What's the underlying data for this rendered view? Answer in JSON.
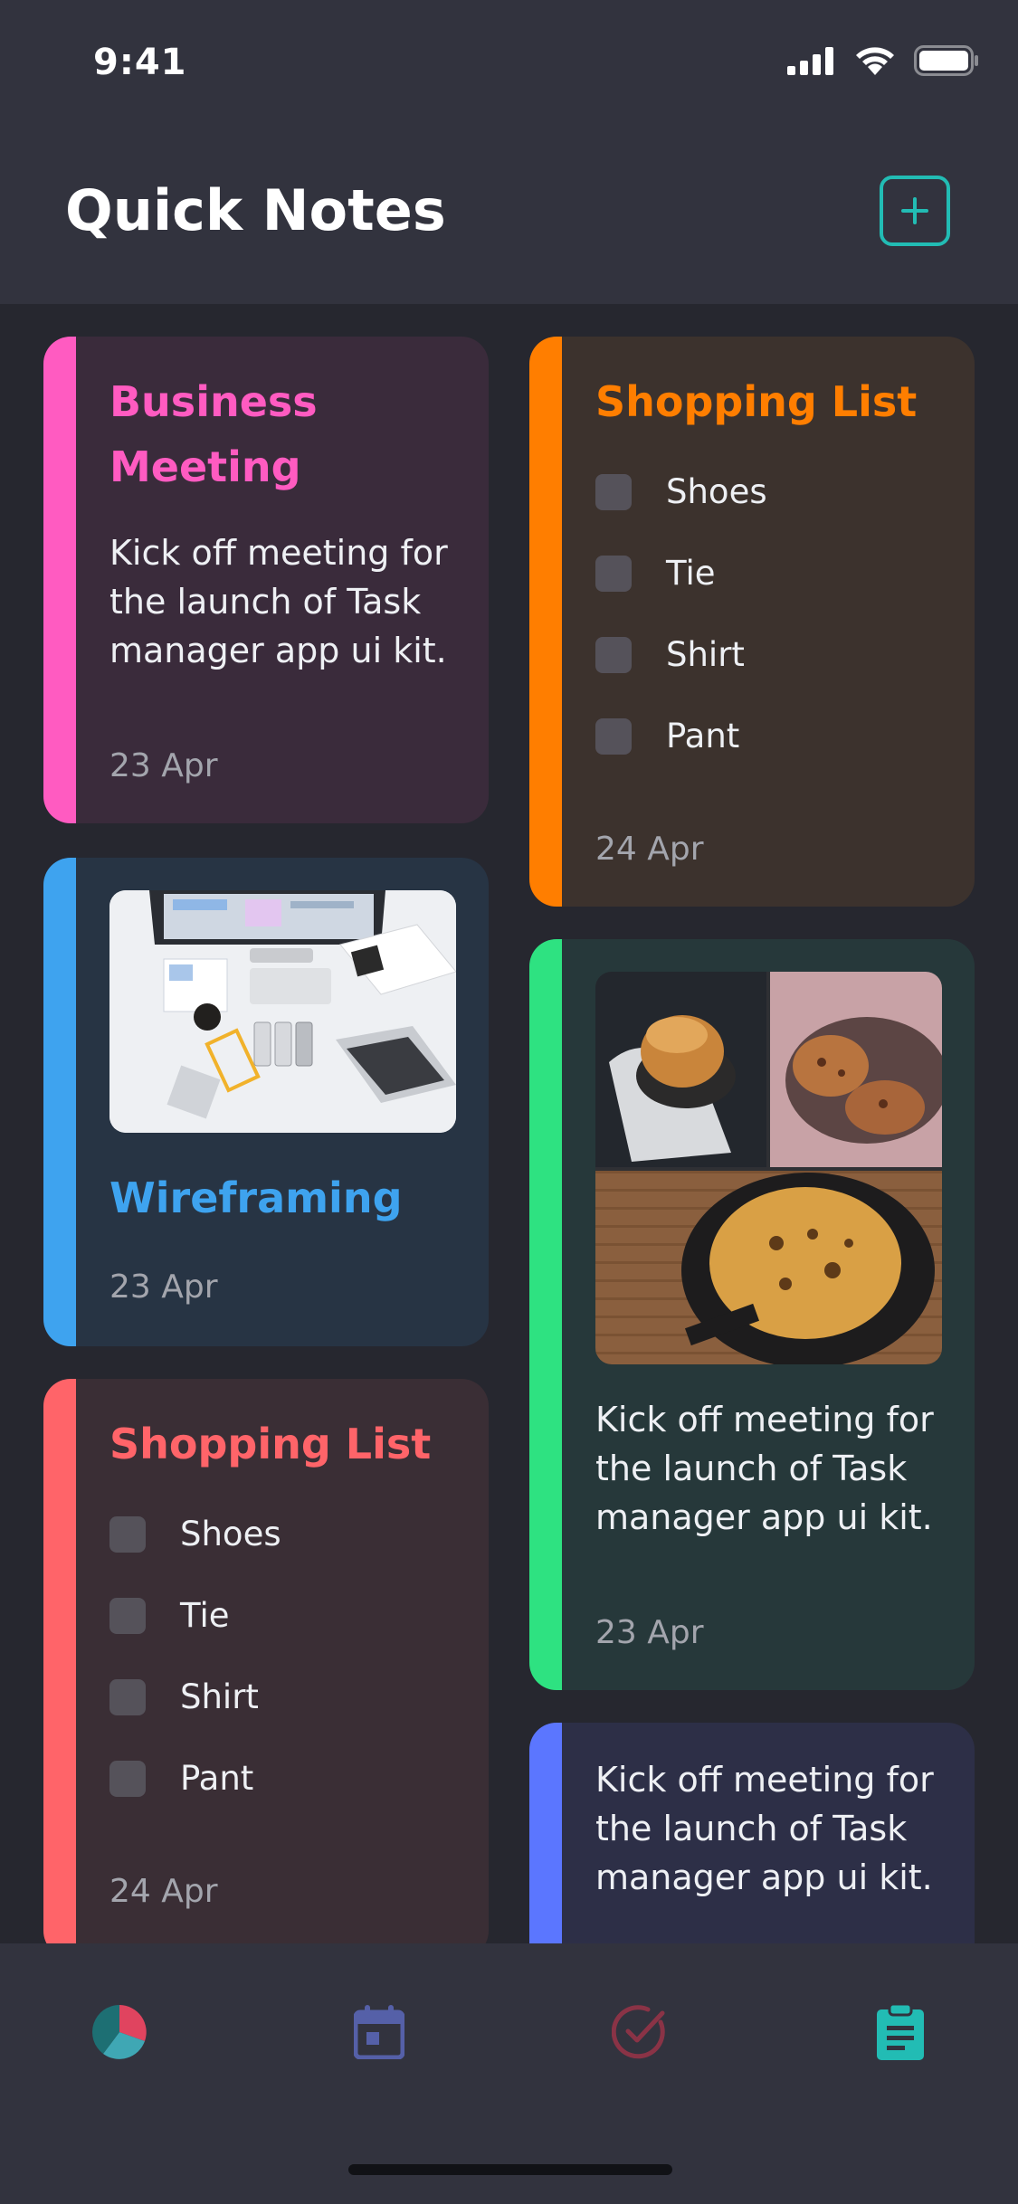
{
  "status": {
    "time": "9:41"
  },
  "header": {
    "title": "Quick Notes"
  },
  "notes": [
    {
      "type": "text",
      "title_line1": "Business",
      "title_line2": "Meeting",
      "body": [
        "Kick off meeting for",
        "the launch of Task",
        "manager app ui kit."
      ],
      "date": "23 Apr",
      "accent": "#ff5bc1",
      "bg": "#3a2b3b"
    },
    {
      "type": "checklist",
      "title": "Shopping List",
      "items": [
        "Shoes",
        "Tie",
        "Shirt",
        "Pant"
      ],
      "date": "24 Apr",
      "accent": "#ff7e00",
      "bg": "#3c322d"
    },
    {
      "type": "image",
      "title": "Wireframing",
      "image": "desk-workspace-photo",
      "date": "23 Apr",
      "accent": "#3ea3ef",
      "bg": "#273444"
    },
    {
      "type": "image-text",
      "image": "food-photo-collage",
      "body": [
        "Kick off meeting for",
        "the launch of Task",
        "manager app ui kit."
      ],
      "date": "23 Apr",
      "accent": "#2ee281",
      "bg": "#26383a"
    },
    {
      "type": "checklist",
      "title": "Shopping List",
      "items": [
        "Shoes",
        "Tie",
        "Shirt",
        "Pant"
      ],
      "date": "24 Apr",
      "accent": "#ff6469",
      "bg": "#3a2e35"
    },
    {
      "type": "text",
      "body": [
        "Kick off meeting for",
        "the launch of Task",
        "manager app ui kit."
      ],
      "accent": "#5b76ff",
      "bg": "#2d2f47"
    }
  ],
  "tabbar": {
    "items": [
      {
        "icon": "pie-chart-icon"
      },
      {
        "icon": "calendar-icon"
      },
      {
        "icon": "check-circle-icon"
      },
      {
        "icon": "clipboard-icon",
        "active": true
      }
    ]
  }
}
